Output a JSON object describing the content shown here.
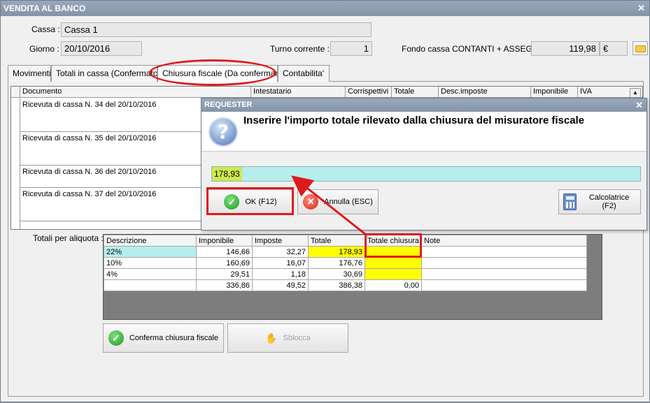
{
  "window": {
    "title": "VENDITA AL BANCO"
  },
  "header": {
    "cassa_label": "Cassa :",
    "cassa_value": "Cassa 1",
    "giorno_label": "Giorno :",
    "giorno_value": "20/10/2016",
    "turno_label": "Turno corrente :",
    "turno_value": "1",
    "fondo_label": "Fondo cassa CONTANTI + ASSEGNI :",
    "fondo_value": "119,98",
    "fondo_currency": "€"
  },
  "tabs": [
    {
      "label": "Movimenti"
    },
    {
      "label": "Totali in cassa (Confermato)"
    },
    {
      "label": "Chiusura fiscale (Da confermare)"
    },
    {
      "label": "Contabilita'"
    }
  ],
  "grid": {
    "columns": [
      "Documento",
      "Intestatario",
      "Corrispettivi",
      "Totale",
      "Desc.imposte",
      "Imponibile",
      "IVA"
    ],
    "rows": [
      {
        "documento": "Ricevuta di cassa N. 34 del 20/10/2016"
      },
      {
        "documento": "Ricevuta di cassa N. 35 del 20/10/2016"
      },
      {
        "documento": "Ricevuta di cassa N. 36 del 20/10/2016"
      },
      {
        "documento": "Ricevuta di cassa N. 37 del 20/10/2016"
      }
    ]
  },
  "totals": {
    "label": "Totali per aliquota :",
    "columns": [
      "Descrizione",
      "Imponibile",
      "Imposte",
      "Totale",
      "Totale chiusura",
      "Note"
    ],
    "rows": [
      {
        "descrizione": "22%",
        "imponibile": "146,66",
        "imposte": "32,27",
        "totale": "178,93",
        "totale_chiusura": ""
      },
      {
        "descrizione": "10%",
        "imponibile": "160,69",
        "imposte": "16,07",
        "totale": "176,76",
        "totale_chiusura": ""
      },
      {
        "descrizione": "4%",
        "imponibile": "29,51",
        "imposte": "1,18",
        "totale": "30,69",
        "totale_chiusura": ""
      },
      {
        "descrizione": "",
        "imponibile": "336,86",
        "imposte": "49,52",
        "totale": "386,38",
        "totale_chiusura": "0,00"
      }
    ]
  },
  "actions": {
    "conferma_label": "Conferma chiusura fiscale",
    "sblocca_label": "Sblocca"
  },
  "dialog": {
    "title": "REQUESTER",
    "prompt": "Inserire l'importo totale rilevato dalla chiusura del misuratore fiscale",
    "input_value": "178,93",
    "ok_label": "OK (F12)",
    "annulla_label": "Annulla (ESC)",
    "calc_label": "Calcolatrice (F2)"
  },
  "colors": {
    "highlight_cyan": "#b6eeee",
    "highlight_yellow": "#ffff00",
    "annotation_red": "#e0191b"
  }
}
